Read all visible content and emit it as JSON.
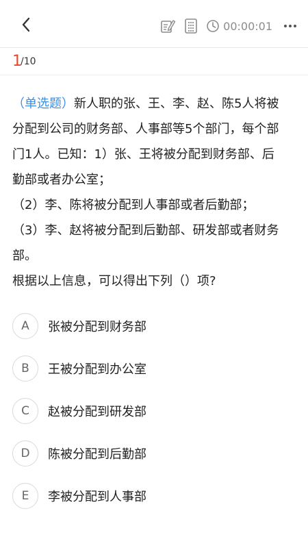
{
  "header": {
    "timer": "00:00:01",
    "icons": [
      "back-icon",
      "answer-sheet-edit-icon",
      "calculator-icon",
      "clock-icon",
      "more-icon"
    ]
  },
  "progress": {
    "current": "1",
    "total": "/10"
  },
  "question": {
    "type_label": "（单选题）",
    "line1_rest": "新人职的张、王、李、赵、陈5人将被",
    "line2": "分配到公司的财务部、人事部等5个部门，每个部",
    "line3": "门1人。已知：1）张、王将被分配到财务部、后",
    "line4": "勤部或者办公室；",
    "line5": "（2）李、陈将被分配到人事部或者后勤部；",
    "line6": "（3）李、赵将被分配到后勤部、研发部或者财务",
    "line7": "部。",
    "line8": "根据以上信息，可以得出下列（）项?"
  },
  "options": [
    {
      "letter": "A",
      "text": "张被分配到财务部"
    },
    {
      "letter": "B",
      "text": "王被分配到办公室"
    },
    {
      "letter": "C",
      "text": "赵被分配到研发部"
    },
    {
      "letter": "D",
      "text": "陈被分配到后勤部"
    },
    {
      "letter": "E",
      "text": "李被分配到人事部"
    }
  ],
  "colors": {
    "accent_red": "#e8462f",
    "accent_blue": "#3a8ee6",
    "icon_gray": "#8c8c8c"
  }
}
